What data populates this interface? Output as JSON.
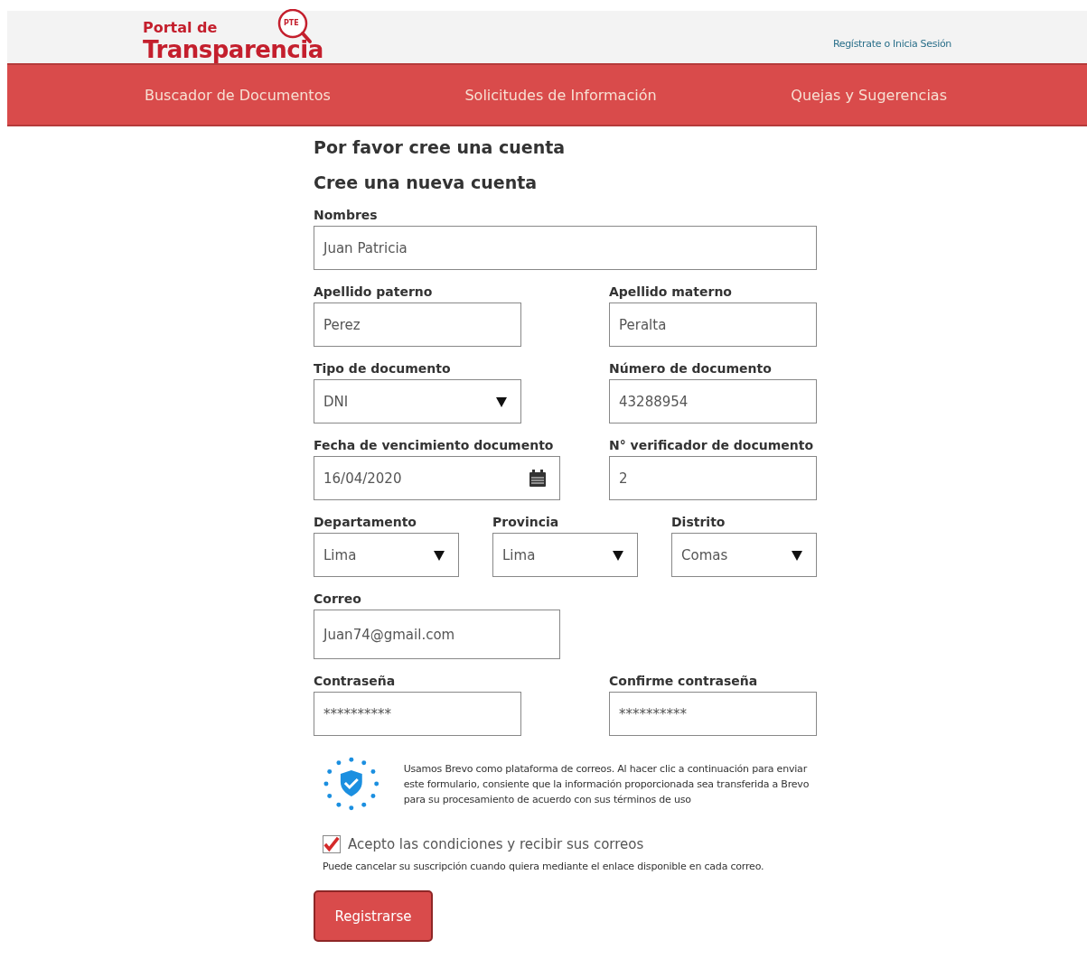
{
  "header": {
    "logo": {
      "line1": "Portal de",
      "line2": "Transparencia",
      "badge": "PTE"
    },
    "auth_link": "Regístrate o Inicia Sesión"
  },
  "nav": [
    {
      "label": "Buscador de Documentos"
    },
    {
      "label": "Solicitudes de Información"
    },
    {
      "label": "Quejas y Sugerencias"
    }
  ],
  "form": {
    "intro": "Por favor cree una cuenta",
    "title": "Cree una nueva cuenta",
    "rows": [
      {
        "kind": "full",
        "fields": [
          {
            "label": "Nombres",
            "kind": "text",
            "value": "Juan Patricia"
          }
        ]
      },
      {
        "kind": "pair",
        "fields": [
          {
            "label": "Apellido paterno",
            "kind": "text",
            "value": "Perez"
          },
          {
            "label": "Apellido materno",
            "kind": "text",
            "value": "Peralta"
          }
        ]
      },
      {
        "kind": "pair",
        "fields": [
          {
            "label": "Tipo de documento",
            "kind": "select",
            "value": "DNI"
          },
          {
            "label": "Número de documento",
            "kind": "text",
            "value": "43288954"
          }
        ]
      },
      {
        "kind": "pair-wide",
        "fields": [
          {
            "label": "Fecha de vencimiento documento",
            "kind": "date",
            "value": "16/04/2020"
          },
          {
            "label": "N° verificador de documento",
            "kind": "text",
            "value": "2"
          }
        ]
      },
      {
        "kind": "triple",
        "fields": [
          {
            "label": "Departamento",
            "kind": "select",
            "value": "Lima"
          },
          {
            "label": "Provincia",
            "kind": "select",
            "value": "Lima"
          },
          {
            "label": "Distrito",
            "kind": "select",
            "value": "Comas"
          }
        ]
      },
      {
        "kind": "single",
        "fields": [
          {
            "label": "Correo",
            "kind": "text",
            "value": "Juan74@gmail.com"
          }
        ]
      },
      {
        "kind": "pair",
        "fields": [
          {
            "label": "Contraseña",
            "kind": "password",
            "value": "**********"
          },
          {
            "label": "Confirme contraseña",
            "kind": "password",
            "value": "**********"
          }
        ]
      }
    ],
    "notice": "Usamos Brevo como plataforma de correos. Al hacer clic a continuación para enviar este formulario, consiente que la información proporcionada sea transferida a Brevo para su procesamiento de acuerdo con sus términos de uso",
    "consent": {
      "label": "Acepto las condiciones y recibir sus correos",
      "checked": true
    },
    "unsubscribe_note": "Puede cancelar su suscripción cuando quiera mediante el enlace disponible en cada correo.",
    "submit": "Registrarse"
  }
}
